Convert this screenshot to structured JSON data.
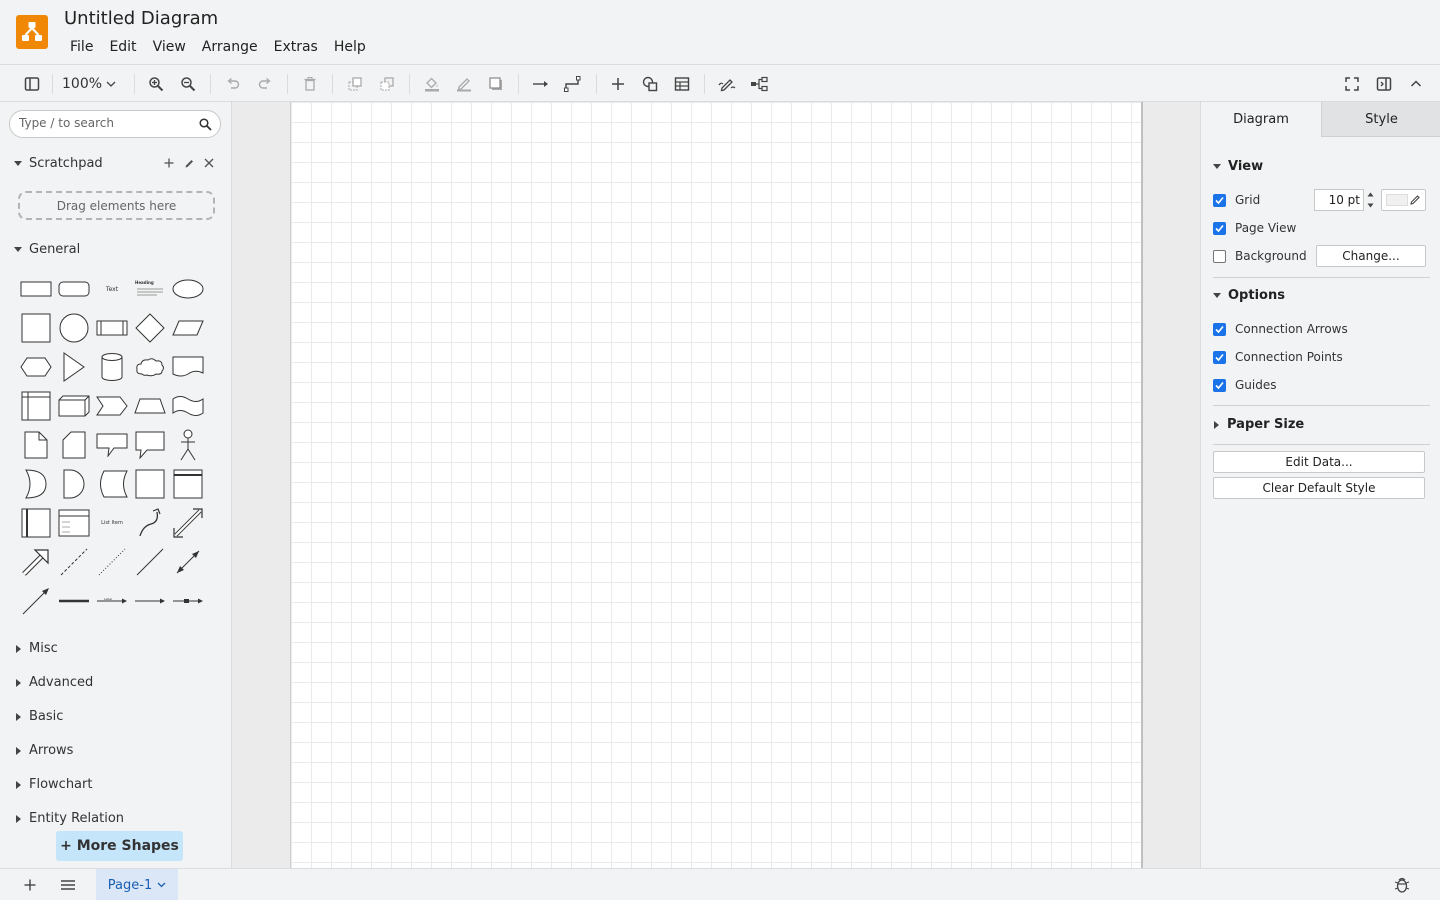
{
  "app": {
    "title": "Untitled Diagram",
    "brand_color": "#f08705"
  },
  "menu": [
    "File",
    "Edit",
    "View",
    "Arrange",
    "Extras",
    "Help"
  ],
  "toolbar": {
    "zoom": "100%",
    "icons": [
      "sidebar-toggle-icon",
      "zoom-in-icon",
      "zoom-out-icon",
      "undo-icon",
      "redo-icon",
      "delete-icon",
      "to-front-icon",
      "to-back-icon",
      "fill-color-icon",
      "line-color-icon",
      "shadow-icon",
      "connection-icon",
      "waypoints-icon",
      "insert-icon",
      "shapes-icon",
      "table-icon",
      "freehand-icon",
      "layout-icon",
      "fullscreen-icon",
      "format-panel-icon",
      "collapse-icon"
    ]
  },
  "sidebar": {
    "search_placeholder": "Type / to search",
    "scratchpad": {
      "label": "Scratchpad",
      "drop_hint": "Drag elements here"
    },
    "general_label": "General",
    "general_text_labels": {
      "text": "Text",
      "heading": "Heading",
      "list_item": "List Item"
    },
    "collapsed_sections": [
      "Misc",
      "Advanced",
      "Basic",
      "Arrows",
      "Flowchart",
      "Entity Relation"
    ],
    "more_shapes": "+ More Shapes"
  },
  "format_panel": {
    "tabs": [
      "Diagram",
      "Style"
    ],
    "active_tab": "Diagram",
    "view": {
      "label": "View",
      "grid": {
        "label": "Grid",
        "checked": true,
        "size": "10 pt"
      },
      "page_view": {
        "label": "Page View",
        "checked": true
      },
      "background": {
        "label": "Background",
        "checked": false,
        "button": "Change..."
      }
    },
    "options": {
      "label": "Options",
      "items": [
        {
          "label": "Connection Arrows",
          "checked": true
        },
        {
          "label": "Connection Points",
          "checked": true
        },
        {
          "label": "Guides",
          "checked": true
        }
      ]
    },
    "paper_size": {
      "label": "Paper Size"
    },
    "buttons": {
      "edit_data": "Edit Data...",
      "clear_default_style": "Clear Default Style"
    },
    "accent_color": "#1a73e8"
  },
  "footer": {
    "page_tab": "Page-1"
  }
}
